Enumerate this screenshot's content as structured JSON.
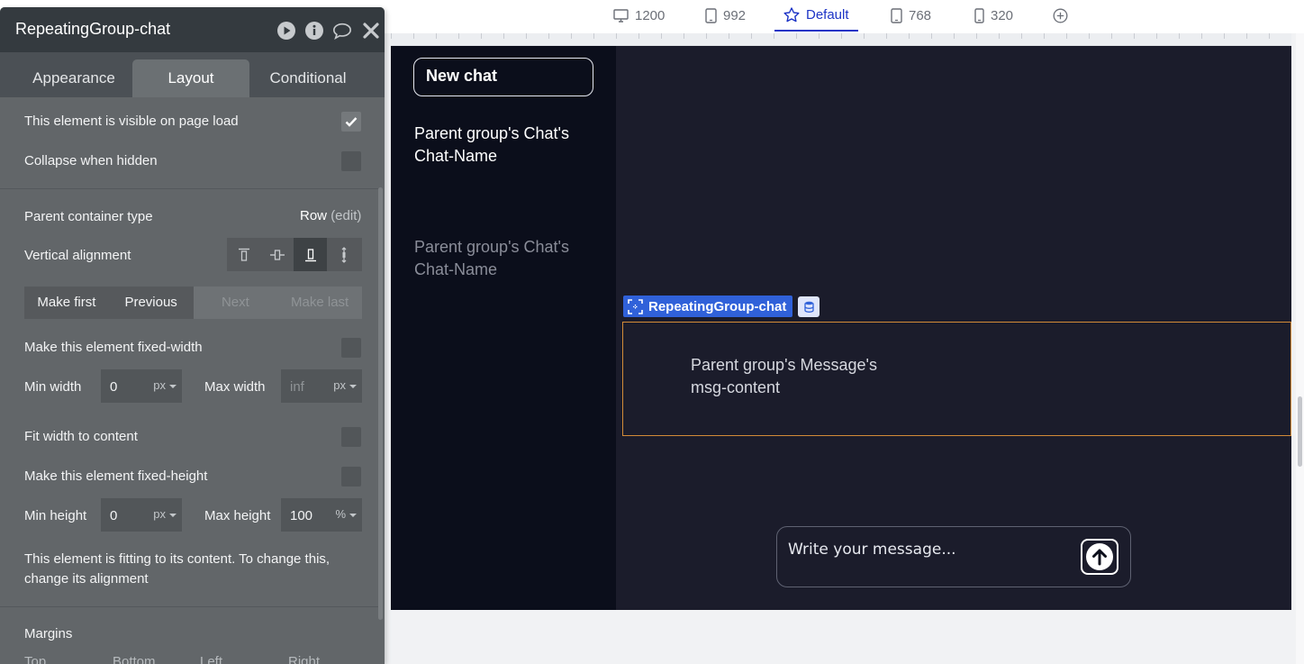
{
  "breakpoints": [
    {
      "label": "1200",
      "icon": "desktop-icon"
    },
    {
      "label": "992",
      "icon": "tablet-icon"
    },
    {
      "label": "Default",
      "icon": "star-icon"
    },
    {
      "label": "768",
      "icon": "tablet-icon"
    },
    {
      "label": "320",
      "icon": "phone-icon"
    }
  ],
  "canvas": {
    "new_chat_label": "New chat",
    "chat_items": [
      "Parent group's Chat's Chat-Name",
      "Parent group's Chat's Chat-Name"
    ],
    "repeating_group_label": "RepeatingGroup-chat",
    "message_text": "Parent group's Message's msg-content",
    "composer_placeholder": "Write your message...",
    "colors": {
      "sidebar_bg": "#0b0e1b",
      "main_bg": "#1b1c2b",
      "selection_border": "#d38b37",
      "label_bg": "#3061d9"
    }
  },
  "panel": {
    "title": "RepeatingGroup-chat",
    "header_icons": [
      "play-icon",
      "info-icon",
      "comment-icon",
      "close-icon"
    ],
    "tabs": [
      "Appearance",
      "Layout",
      "Conditional"
    ],
    "active_tab": "Layout",
    "visible_on_load_label": "This element is visible on page load",
    "visible_on_load_checked": true,
    "collapse_label": "Collapse when hidden",
    "collapse_checked": false,
    "parent_container_label": "Parent container type",
    "parent_container_value": "Row",
    "parent_container_edit": "(edit)",
    "vertical_alignment_label": "Vertical alignment",
    "vertical_alignment_selected": "bottom",
    "order_buttons": [
      "Make first",
      "Previous",
      "Next",
      "Make last"
    ],
    "fixed_width_label": "Make this element fixed-width",
    "min_width_label": "Min width",
    "min_width_value": "0",
    "min_width_unit": "px",
    "max_width_label": "Max width",
    "max_width_placeholder": "inf",
    "max_width_unit": "px",
    "fit_width_label": "Fit width to content",
    "fixed_height_label": "Make this element fixed-height",
    "min_height_label": "Min height",
    "min_height_value": "0",
    "min_height_unit": "px",
    "max_height_label": "Max height",
    "max_height_value": "100",
    "max_height_unit": "%",
    "fit_note": "This element is fitting to its content. To change this, change its alignment",
    "margins_label": "Margins",
    "margin_sides": [
      "Top",
      "Bottom",
      "Left",
      "Right"
    ]
  }
}
